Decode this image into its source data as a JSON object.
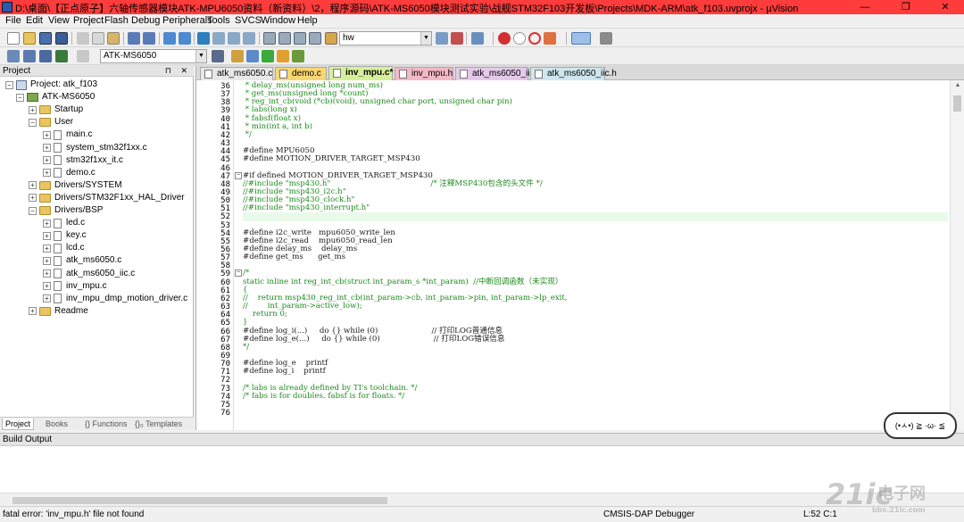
{
  "window": {
    "title": "D:\\桌面\\【正点原子】六轴传感器模块ATK-MPU6050资料（新资料）\\2，程序源码\\ATK-MS6050模块测试实验\\战舰STM32F103开发板\\Projects\\MDK-ARM\\atk_f103.uvprojx - µVision",
    "minimize": "—",
    "maximize": "❐",
    "close": "✕"
  },
  "menu": [
    "File",
    "Edit",
    "View",
    "Project",
    "Flash",
    "Debug",
    "Peripherals",
    "Tools",
    "SVCS",
    "Window",
    "Help"
  ],
  "toolbar": {
    "find_value": "hw",
    "target_value": "ATK-MS6050"
  },
  "project_panel": {
    "title": "Project",
    "header_buttons": "⊓ ✕",
    "tree": [
      {
        "label": "Project: atk_f103",
        "type": "project",
        "expander": "−"
      },
      {
        "label": "ATK-MS6050",
        "type": "target",
        "expander": "−"
      },
      {
        "label": "Startup",
        "type": "folder",
        "expander": "+"
      },
      {
        "label": "User",
        "type": "folder",
        "expander": "−"
      },
      {
        "label": "main.c",
        "type": "file",
        "expander": "+"
      },
      {
        "label": "system_stm32f1xx.c",
        "type": "file",
        "expander": "+"
      },
      {
        "label": "stm32f1xx_it.c",
        "type": "file",
        "expander": "+"
      },
      {
        "label": "demo.c",
        "type": "file",
        "expander": "+"
      },
      {
        "label": "Drivers/SYSTEM",
        "type": "folder",
        "expander": "+"
      },
      {
        "label": "Drivers/STM32F1xx_HAL_Driver",
        "type": "folder",
        "expander": "+"
      },
      {
        "label": "Drivers/BSP",
        "type": "folder",
        "expander": "−"
      },
      {
        "label": "led.c",
        "type": "file",
        "expander": "+"
      },
      {
        "label": "key.c",
        "type": "file",
        "expander": "+"
      },
      {
        "label": "lcd.c",
        "type": "file",
        "expander": "+"
      },
      {
        "label": "atk_ms6050.c",
        "type": "file",
        "expander": "+"
      },
      {
        "label": "atk_ms6050_iic.c",
        "type": "file",
        "expander": "+"
      },
      {
        "label": "inv_mpu.c",
        "type": "file",
        "expander": "+"
      },
      {
        "label": "inv_mpu_dmp_motion_driver.c",
        "type": "file",
        "expander": "+"
      },
      {
        "label": "Readme",
        "type": "folder",
        "expander": "+"
      }
    ],
    "tabs": [
      "Project",
      "Books",
      "{} Functions",
      "{}₀ Templates"
    ]
  },
  "editor": {
    "tabs": [
      {
        "label": "atk_ms6050.c",
        "color": "#e8e8e8"
      },
      {
        "label": "demo.c",
        "color": "#f7d774"
      },
      {
        "label": "inv_mpu.c*",
        "color": "#d8ef9a"
      },
      {
        "label": "inv_mpu.h",
        "color": "#f3b9c6"
      },
      {
        "label": "atk_ms6050_iic.c",
        "color": "#e5c9ea"
      },
      {
        "label": "atk_ms6050_iic.h",
        "color": "#cfe6ee"
      }
    ],
    "active_tab_index": 2,
    "current_line": 52,
    "lines": [
      {
        "n": "36",
        "t": " * delay_ms(unsigned long num_ms)",
        "c": "cmt"
      },
      {
        "n": "37",
        "t": " * get_ms(unsigned long *count)",
        "c": "cmt"
      },
      {
        "n": "38",
        "t": " * reg_int_cb(void (*cb)(void), unsigned char port, unsigned char pin)",
        "c": "cmt"
      },
      {
        "n": "39",
        "t": " * labs(long x)",
        "c": "cmt"
      },
      {
        "n": "40",
        "t": " * fabsf(float x)",
        "c": "cmt"
      },
      {
        "n": "41",
        "t": " * min(int a, int b)",
        "c": "cmt"
      },
      {
        "n": "42",
        "t": " */",
        "c": "cmt"
      },
      {
        "n": "43",
        "t": "",
        "c": "kw"
      },
      {
        "n": "44",
        "t": "#define MPU6050",
        "c": "kw"
      },
      {
        "n": "45",
        "t": "#define MOTION_DRIVER_TARGET_MSP430",
        "c": "kw"
      },
      {
        "n": "46",
        "t": "",
        "c": "kw"
      },
      {
        "n": "47",
        "t": "#if defined MOTION_DRIVER_TARGET_MSP430",
        "c": "kw"
      },
      {
        "n": "48",
        "t": "//#include \"msp430.h\"                                         /* 注释MSP430包含的头文件 */",
        "c": "cmt"
      },
      {
        "n": "49",
        "t": "//#include \"msp430_i2c.h\"",
        "c": "cmt"
      },
      {
        "n": "50",
        "t": "//#include \"msp430_clock.h\"",
        "c": "cmt"
      },
      {
        "n": "51",
        "t": "//#include \"msp430_interrupt.h\"",
        "c": "cmt"
      },
      {
        "n": "52",
        "t": "",
        "c": "kw"
      },
      {
        "n": "53",
        "t": "",
        "c": "kw"
      },
      {
        "n": "54",
        "t": "#define i2c_write   mpu6050_write_len",
        "c": "kw"
      },
      {
        "n": "55",
        "t": "#define i2c_read    mpu6050_read_len",
        "c": "kw"
      },
      {
        "n": "56",
        "t": "#define delay_ms    delay_ms",
        "c": "kw"
      },
      {
        "n": "57",
        "t": "#define get_ms      get_ms",
        "c": "kw"
      },
      {
        "n": "58",
        "t": "",
        "c": "kw"
      },
      {
        "n": "59",
        "t": "/*",
        "c": "cmt"
      },
      {
        "n": "60",
        "t": "static inline int reg_int_cb(struct int_param_s *int_param)  //中断回调函数（未实现）",
        "c": "cmt"
      },
      {
        "n": "61",
        "t": "{",
        "c": "cmt"
      },
      {
        "n": "62",
        "t": "//    return msp430_reg_int_cb(int_param->cb, int_param->pin, int_param->lp_exit,",
        "c": "cmt"
      },
      {
        "n": "63",
        "t": "//        int_param->active_low);",
        "c": "cmt"
      },
      {
        "n": "64",
        "t": "    return 0;",
        "c": "cmt"
      },
      {
        "n": "65",
        "t": "}",
        "c": "cmt"
      },
      {
        "n": "66",
        "t": "#define log_i(...)     do {} while (0)                      // 打印LOG普通信息",
        "c": "kw"
      },
      {
        "n": "67",
        "t": "#define log_e(...)     do {} while (0)                      // 打印LOG错误信息",
        "c": "kw"
      },
      {
        "n": "68",
        "t": "*/",
        "c": "cmt"
      },
      {
        "n": "69",
        "t": "",
        "c": "kw"
      },
      {
        "n": "70",
        "t": "#define log_e    printf",
        "c": "kw"
      },
      {
        "n": "71",
        "t": "#define log_i    printf",
        "c": "kw"
      },
      {
        "n": "72",
        "t": "",
        "c": "kw"
      },
      {
        "n": "73",
        "t": "/* labs is already defined by TI's toolchain. */",
        "c": "cmt"
      },
      {
        "n": "74",
        "t": "/* fabs is for doubles. fabsf is for floats. */",
        "c": "cmt"
      },
      {
        "n": "75",
        "t": "",
        "c": "kw"
      },
      {
        "n": "76",
        "t": "",
        "c": "kw"
      }
    ]
  },
  "build_output": {
    "title": "Build Output",
    "text": ""
  },
  "status": {
    "message": "fatal error: 'inv_mpu.h' file not found",
    "debugger": "CMSIS-DAP Debugger",
    "position": "L:52 C:1"
  },
  "mascot": {
    "text": "(•ㅅ•) ≧ ·ω· ≦"
  },
  "watermark": {
    "big": "21ic",
    "cn": "电子网",
    "url": "bbs.21ic.com"
  }
}
